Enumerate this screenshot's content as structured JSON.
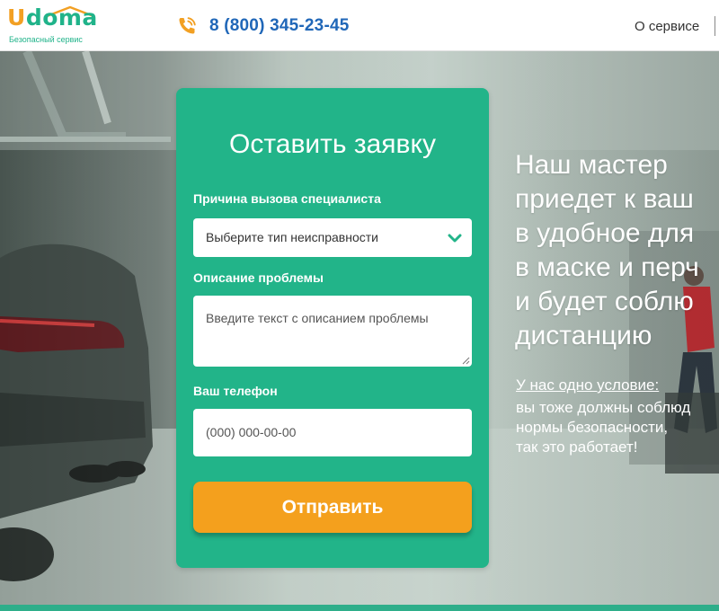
{
  "header": {
    "logo": {
      "brand_first": "U",
      "brand_rest": "doma",
      "tagline": "Безопасный сервис"
    },
    "phone": {
      "icon": "phone-icon",
      "number": "8 (800) 345-23-45"
    },
    "nav": {
      "about": "О сервисе"
    }
  },
  "form": {
    "title": "Оставить заявку",
    "reason_label": "Причина вызова специалиста",
    "reason_value": "Выберите тип неисправности",
    "description_label": "Описание проблемы",
    "description_placeholder": "Введите текст с описанием проблемы",
    "phone_label": "Ваш телефон",
    "phone_placeholder": "(000) 000-00-00",
    "submit_label": "Отправить"
  },
  "hero": {
    "headline_lines": [
      "Наш мастер",
      "приедет к ваш",
      "в удобное для",
      "в маске и перч",
      "и будет соблю",
      "дистанцию"
    ],
    "condition_link": "У нас одно условие:",
    "condition_lines": [
      "вы тоже должны соблюд",
      "нормы безопасности,",
      "так это работает!"
    ]
  },
  "colors": {
    "brand_green": "#22b489",
    "accent_orange": "#f4a01d",
    "phone_blue": "#2067b8"
  }
}
